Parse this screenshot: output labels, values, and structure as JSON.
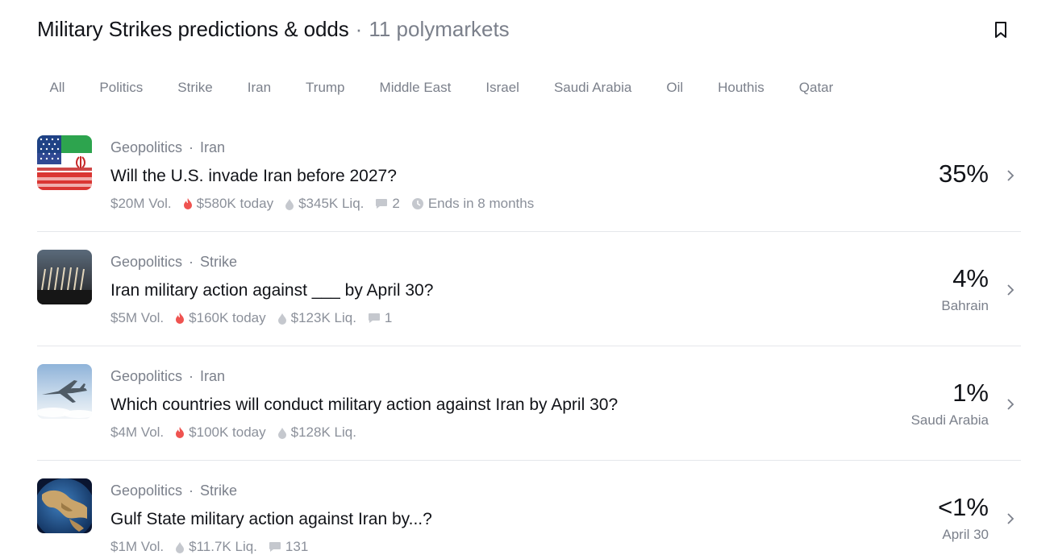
{
  "header": {
    "title": "Military Strikes predictions & odds",
    "separator": "·",
    "count": "11 polymarkets"
  },
  "tabs": [
    "All",
    "Politics",
    "Strike",
    "Iran",
    "Trump",
    "Middle East",
    "Israel",
    "Saudi Arabia",
    "Oil",
    "Houthis",
    "Qatar"
  ],
  "markets": [
    {
      "category": "Geopolitics",
      "tag": "Iran",
      "title": "Will the U.S. invade Iran before 2027?",
      "volume": "$20M Vol.",
      "today": "$580K today",
      "liquidity": "$345K Liq.",
      "comments": "2",
      "ends": "Ends in 8 months",
      "percent": "35%",
      "outcome": ""
    },
    {
      "category": "Geopolitics",
      "tag": "Strike",
      "title": "Iran military action against ___ by April 30?",
      "volume": "$5M Vol.",
      "today": "$160K today",
      "liquidity": "$123K Liq.",
      "comments": "1",
      "percent": "4%",
      "outcome": "Bahrain"
    },
    {
      "category": "Geopolitics",
      "tag": "Iran",
      "title": "Which countries will conduct military action against Iran by April 30?",
      "volume": "$4M Vol.",
      "today": "$100K today",
      "liquidity": "$128K Liq.",
      "percent": "1%",
      "outcome": "Saudi Arabia"
    },
    {
      "category": "Geopolitics",
      "tag": "Strike",
      "title": "Gulf State military action against Iran by...?",
      "volume": "$1M Vol.",
      "liquidity": "$11.7K Liq.",
      "comments": "131",
      "percent": "<1%",
      "outcome": "April 30"
    }
  ],
  "colors": {
    "text": "#111318",
    "muted": "#7b808b",
    "fire": "#ef5350",
    "divider": "#e5e7eb"
  },
  "icons": [
    "bookmark-icon",
    "fire-icon",
    "droplet-icon",
    "comment-icon",
    "clock-icon",
    "chevron-right-icon"
  ]
}
